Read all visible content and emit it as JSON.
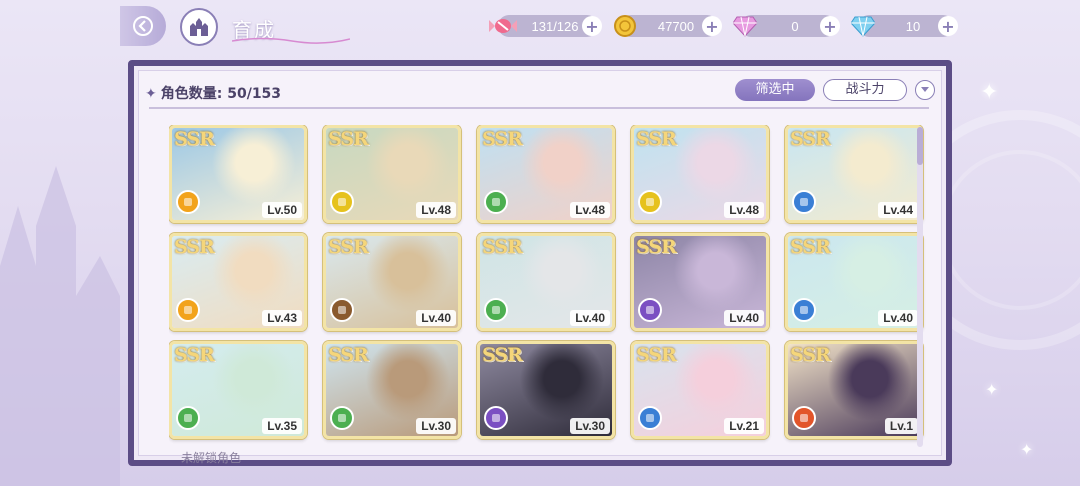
{
  "header": {
    "title": "育成",
    "back_icon": "back-arrow-icon",
    "home_icon": "castle-icon"
  },
  "resources": [
    {
      "icon": "candy-icon",
      "value": "131/126"
    },
    {
      "icon": "gold-coin-icon",
      "value": "47700"
    },
    {
      "icon": "pink-diamond-icon",
      "value": "0"
    },
    {
      "icon": "blue-diamond-icon",
      "value": "10"
    }
  ],
  "panel": {
    "count_label": "角色数量:",
    "count_value": "50/153",
    "filter_label": "筛选中",
    "sort_label": "战斗力",
    "footer_hint": "未解锁角色"
  },
  "colors": {
    "frame": "#5c4d86",
    "accent": "#8474bd",
    "card_border": "#f3e4a6"
  },
  "cards": [
    {
      "rarity": "SSR",
      "level": "Lv.50",
      "element_color": "#f2a31b",
      "art": [
        "#9cc8e6",
        "#f7efd6"
      ]
    },
    {
      "rarity": "SSR",
      "level": "Lv.48",
      "element_color": "#e6c21d",
      "art": [
        "#c7d9c1",
        "#e9d9b8"
      ]
    },
    {
      "rarity": "SSR",
      "level": "Lv.48",
      "element_color": "#4caf50",
      "art": [
        "#bfe0f2",
        "#f1d1c8"
      ]
    },
    {
      "rarity": "SSR",
      "level": "Lv.48",
      "element_color": "#e6c21d",
      "art": [
        "#bfe3f0",
        "#ecd8e6"
      ]
    },
    {
      "rarity": "SSR",
      "level": "Lv.44",
      "element_color": "#3a7fd5",
      "art": [
        "#c8e6f2",
        "#f4ebcf"
      ]
    },
    {
      "rarity": "SSR",
      "level": "Lv.43",
      "element_color": "#f2a31b",
      "art": [
        "#d9ecf2",
        "#f1dcc0"
      ]
    },
    {
      "rarity": "SSR",
      "level": "Lv.40",
      "element_color": "#8a5a2e",
      "art": [
        "#d9e8ee",
        "#d8c09a"
      ]
    },
    {
      "rarity": "SSR",
      "level": "Lv.40",
      "element_color": "#4caf50",
      "art": [
        "#cfe5e6",
        "#e4e6e8"
      ]
    },
    {
      "rarity": "SSR",
      "level": "Lv.40",
      "element_color": "#7b4fc2",
      "art": [
        "#8d85a6",
        "#c9b7d8"
      ]
    },
    {
      "rarity": "SSR",
      "level": "Lv.40",
      "element_color": "#3a7fd5",
      "art": [
        "#cbe7ef",
        "#d6efe4"
      ]
    },
    {
      "rarity": "SSR",
      "level": "Lv.35",
      "element_color": "#4caf50",
      "art": [
        "#d4ecef",
        "#cfe9d8"
      ]
    },
    {
      "rarity": "SSR",
      "level": "Lv.30",
      "element_color": "#4caf50",
      "art": [
        "#cfe4ee",
        "#b99a7a"
      ]
    },
    {
      "rarity": "SSR",
      "level": "Lv.30",
      "element_color": "#7b4fc2",
      "art": [
        "#8f8aa0",
        "#2f2c3a"
      ]
    },
    {
      "rarity": "SSR",
      "level": "Lv.21",
      "element_color": "#3a7fd5",
      "art": [
        "#d8e3ee",
        "#f5cfdc"
      ]
    },
    {
      "rarity": "SSR",
      "level": "Lv.1",
      "element_color": "#e2552a",
      "art": [
        "#f1e2c8",
        "#4a3a5a"
      ]
    }
  ]
}
